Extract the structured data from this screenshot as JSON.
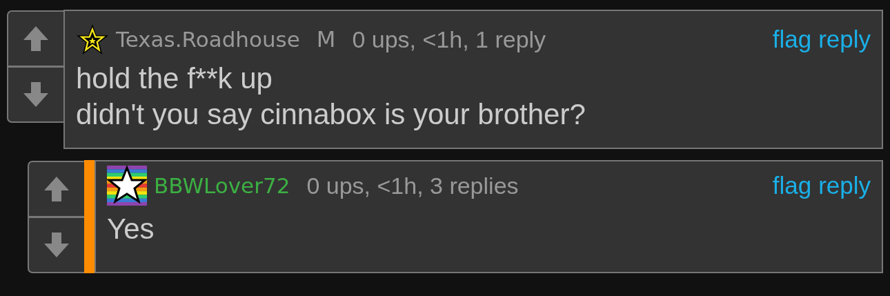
{
  "comments": [
    {
      "kind": "star",
      "username": "Texas.Roadhouse",
      "color": "#999999",
      "tag": "M",
      "meta": "0 ups, <1h, 1 reply",
      "marked": false,
      "actions": [
        "flag",
        "reply"
      ],
      "body": [
        "hold the f**k up",
        "didn't you say cinnabox is your brother?"
      ],
      "children": [
        {
          "kind": "rainbow",
          "username": "BBWLover72",
          "color": "#3cb043",
          "meta": "0 ups, <1h, 3 replies",
          "marked": true,
          "actions": [
            "flag",
            "reply"
          ],
          "body": [
            "Yes"
          ]
        }
      ]
    }
  ]
}
